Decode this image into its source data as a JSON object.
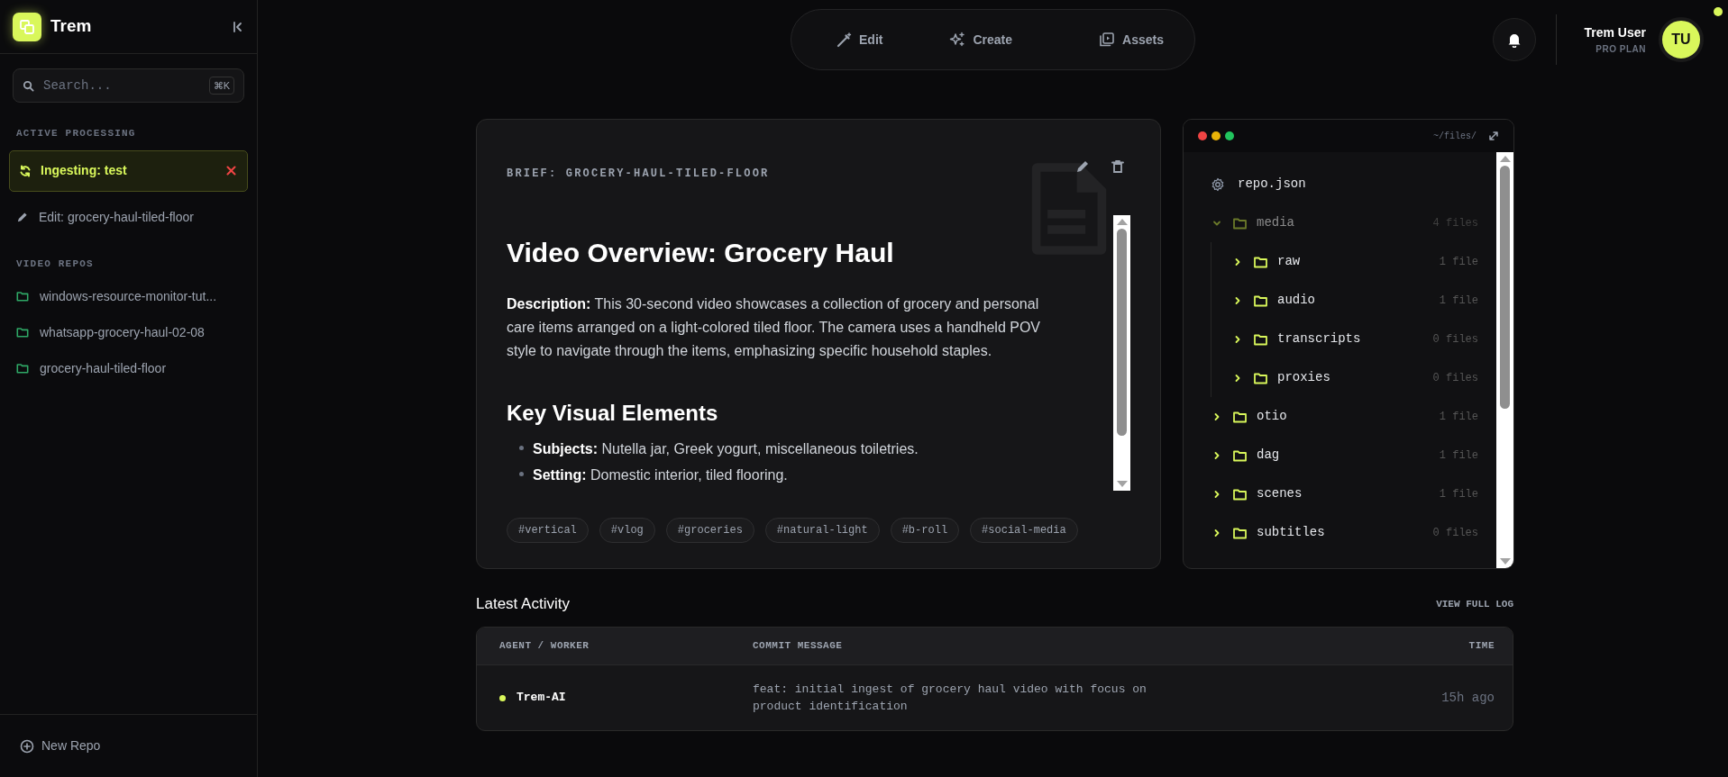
{
  "sidebar": {
    "brand": "Trem",
    "search": {
      "placeholder": "Search...",
      "shortcut": "⌘K"
    },
    "active_heading": "ACTIVE PROCESSING",
    "active_items": [
      {
        "kind": "ingest",
        "label": "Ingesting: test"
      },
      {
        "kind": "edit",
        "label": "Edit: grocery-haul-tiled-floor"
      }
    ],
    "repos_heading": "VIDEO REPOS",
    "repos": [
      {
        "label": "windows-resource-monitor-tut..."
      },
      {
        "label": "whatsapp-grocery-haul-02-08"
      },
      {
        "label": "grocery-haul-tiled-floor"
      }
    ],
    "new_repo": "New Repo"
  },
  "topnav": [
    {
      "label": "Edit",
      "selected": false
    },
    {
      "label": "Create",
      "selected": false
    },
    {
      "label": "Assets",
      "selected": false
    }
  ],
  "user": {
    "name": "Trem User",
    "plan": "PRO PLAN",
    "initials": "TU"
  },
  "brief": {
    "label": "BRIEF: GROCERY-HAUL-TILED-FLOOR",
    "title": "Video Overview: Grocery Haul",
    "description": "**Description:** This 30-second video showcases a collection of grocery and personal care items arranged on a light-colored tiled floor. The camera uses a handheld POV style to navigate through the items, emphasizing specific household staples.",
    "section_title": "Key Visual Elements",
    "bullets": [
      "**Subjects:** Nutella jar, Greek yogurt, miscellaneous toiletries.",
      "**Setting:** Domestic interior, tiled flooring."
    ],
    "tags": [
      "#vertical",
      "#vlog",
      "#groceries",
      "#natural-light",
      "#b-roll",
      "#social-media"
    ]
  },
  "files": {
    "path": "~/files/",
    "tree": [
      {
        "kind": "file",
        "name": "repo.json"
      },
      {
        "kind": "folder",
        "name": "media",
        "count": "4 files",
        "expanded": true,
        "children": [
          {
            "kind": "folder",
            "name": "raw",
            "count": "1 file",
            "expanded": false
          },
          {
            "kind": "folder",
            "name": "audio",
            "count": "1 file",
            "expanded": false
          },
          {
            "kind": "folder",
            "name": "transcripts",
            "count": "0 files",
            "expanded": false
          },
          {
            "kind": "folder",
            "name": "proxies",
            "count": "0 files",
            "expanded": false
          }
        ]
      },
      {
        "kind": "folder",
        "name": "otio",
        "count": "1 file",
        "expanded": false
      },
      {
        "kind": "folder",
        "name": "dag",
        "count": "1 file",
        "expanded": false
      },
      {
        "kind": "folder",
        "name": "scenes",
        "count": "1 file",
        "expanded": false
      },
      {
        "kind": "folder",
        "name": "subtitles",
        "count": "0 files",
        "expanded": false
      }
    ]
  },
  "activity": {
    "title": "Latest Activity",
    "link": "VIEW FULL LOG",
    "columns": [
      "AGENT / WORKER",
      "COMMIT MESSAGE",
      "TIME"
    ],
    "rows": [
      {
        "agent": "Trem-AI",
        "color": "#d9f75b",
        "message": "feat: initial ingest of grocery haul video with focus on product identification",
        "time": "15h ago"
      }
    ]
  }
}
